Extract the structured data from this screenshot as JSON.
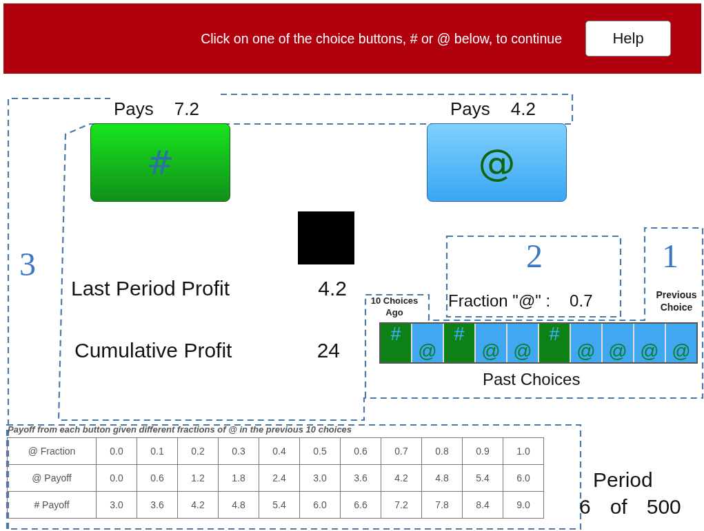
{
  "header": {
    "instruction": "Click on one of the choice buttons, # or @ below, to continue",
    "help_button": "Help"
  },
  "options": [
    {
      "kind": "hash",
      "symbol": "#",
      "pays_label": "Pays",
      "pays_value": "7.2"
    },
    {
      "kind": "at",
      "symbol": "@",
      "pays_label": "Pays",
      "pays_value": "4.2"
    }
  ],
  "annotations": [
    "3",
    "2",
    "1"
  ],
  "profits": [
    {
      "label": "Last Period Profit",
      "value": "4.2"
    },
    {
      "label": "Cumulative Profit",
      "value": "24"
    }
  ],
  "fraction": {
    "label": "Fraction \"@\" :",
    "value": "0.7"
  },
  "past_choices": {
    "title": "Past Choices",
    "oldest_label": "10 Choices Ago",
    "newest_label": "Previous Choice",
    "items": [
      {
        "kind": "hash",
        "symbol": "#"
      },
      {
        "kind": "at",
        "symbol": "@"
      },
      {
        "kind": "hash",
        "symbol": "#"
      },
      {
        "kind": "at",
        "symbol": "@"
      },
      {
        "kind": "at",
        "symbol": "@"
      },
      {
        "kind": "hash",
        "symbol": "#"
      },
      {
        "kind": "at",
        "symbol": "@"
      },
      {
        "kind": "at",
        "symbol": "@"
      },
      {
        "kind": "at",
        "symbol": "@"
      },
      {
        "kind": "at",
        "symbol": "@"
      }
    ]
  },
  "payoff_table": {
    "caption": "Payoff from each button given different fractions of @ in the previous 10 choices",
    "rows": [
      [
        "@ Fraction",
        "0.0",
        "0.1",
        "0.2",
        "0.3",
        "0.4",
        "0.5",
        "0.6",
        "0.7",
        "0.8",
        "0.9",
        "1.0"
      ],
      [
        "@ Payoff",
        "0.0",
        "0.6",
        "1.2",
        "1.8",
        "2.4",
        "3.0",
        "3.6",
        "4.2",
        "4.8",
        "5.4",
        "6.0"
      ],
      [
        "# Payoff",
        "3.0",
        "3.6",
        "4.2",
        "4.8",
        "5.4",
        "6.0",
        "6.6",
        "7.2",
        "7.8",
        "8.4",
        "9.0"
      ]
    ]
  },
  "period": {
    "label": "Period",
    "current": "6",
    "of": "of",
    "total": "500"
  }
}
